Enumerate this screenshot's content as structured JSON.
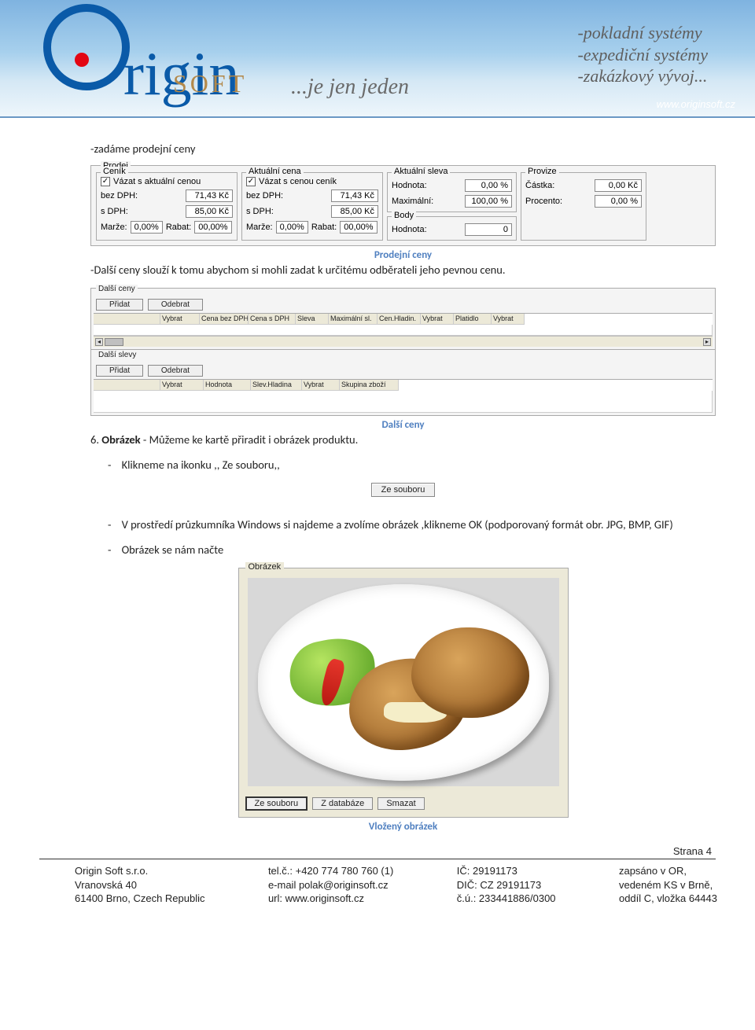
{
  "banner": {
    "logo_word": "rigin",
    "logo_sub": "SOFT",
    "tagline": "...je jen jeden",
    "rightLines": [
      "-pokladní systémy",
      "-expediční systémy",
      "-zakázkový vývoj..."
    ],
    "url": "www.originsoft.cz"
  },
  "section1": {
    "heading": "-zadáme prodejní ceny",
    "panelTitle": "Prodej",
    "cenik": {
      "title": "Ceník",
      "chk": "Vázat s aktuální cenou",
      "bezDPH_lbl": "bez DPH:",
      "bezDPH_val": "71,43 Kč",
      "sDPH_lbl": "s DPH:",
      "sDPH_val": "85,00 Kč",
      "marze_lbl": "Marže:",
      "marze_val": "0,00%",
      "rabat_lbl": "Rabat:",
      "rabat_val": "00,00%"
    },
    "aktcena": {
      "title": "Aktuální cena",
      "chk": "Vázat s cenou ceník",
      "bezDPH_lbl": "bez DPH:",
      "bezDPH_val": "71,43 Kč",
      "sDPH_lbl": "s DPH:",
      "sDPH_val": "85,00 Kč",
      "marze_lbl": "Marže:",
      "marze_val": "0,00%",
      "rabat_lbl": "Rabat:",
      "rabat_val": "00,00%"
    },
    "sleva": {
      "title": "Aktuální sleva",
      "hodnota_lbl": "Hodnota:",
      "hodnota_val": "0,00 %",
      "max_lbl": "Maximální:",
      "max_val": "100,00 %"
    },
    "body": {
      "title": "Body",
      "hodnota_lbl": "Hodnota:",
      "hodnota_val": "0"
    },
    "provize": {
      "title": "Provize",
      "castka_lbl": "Částka:",
      "castka_val": "0,00 Kč",
      "procento_lbl": "Procento:",
      "procento_val": "0,00 %"
    },
    "caption": "Prodejní ceny",
    "para": "-Další ceny slouží k tomu abychom si mohli zadat k určitému odběrateli jeho pevnou cenu."
  },
  "dalsiceny": {
    "title": "Další ceny",
    "pridat": "Přidat",
    "odebrat": "Odebrat",
    "cols": [
      "Vybrat",
      "Cena bez DPH",
      "Cena s DPH",
      "Sleva",
      "Maximální sl.",
      "Cen.Hladin.",
      "Vybrat",
      "Platidlo",
      "Vybrat"
    ]
  },
  "dalsislevy": {
    "title": "Další slevy",
    "pridat": "Přidat",
    "odebrat": "Odebrat",
    "cols": [
      "Vybrat",
      "Hodnota",
      "Slev.Hladina",
      "Vybrat",
      "Skupina zboží"
    ]
  },
  "dalsiCaption": "Další ceny",
  "step6": {
    "num": "6.",
    "title": "Obrázek",
    "text1": " - Můžeme ke kartě přiradit i obrázek produktu.",
    "bullet1": "Klikneme na  ikonku ,, Ze souboru,,",
    "btn": "Ze souboru",
    "bullet2": "V prostředí průzkumníka Windows  si najdeme a zvolíme  obrázek ,klikneme OK (podporovaný formát obr. JPG, BMP, GIF)",
    "bullet3": "Obrázek se nám načte"
  },
  "obrazekPanel": {
    "title": "Obrázek",
    "btn1": "Ze souboru",
    "btn2": "Z databáze",
    "btn3": "Smazat",
    "caption": "Vložený obrázek"
  },
  "pageNum": "Strana 4",
  "footer": {
    "c1": [
      "Origin Soft s.r.o.",
      "Vranovská 40",
      "61400 Brno, Czech Republic"
    ],
    "c2": [
      "tel.č.: +420 774 780 760 (1)",
      "e-mail polak@originsoft.cz",
      "url: www.originsoft.cz"
    ],
    "c3": [
      "IČ: 29191173",
      "DIČ: CZ 29191173",
      "č.ú.: 233441886/0300"
    ],
    "c4": [
      "zapsáno v OR,",
      "vedeném KS v Brně,",
      "oddíl C, vložka 64443"
    ]
  }
}
